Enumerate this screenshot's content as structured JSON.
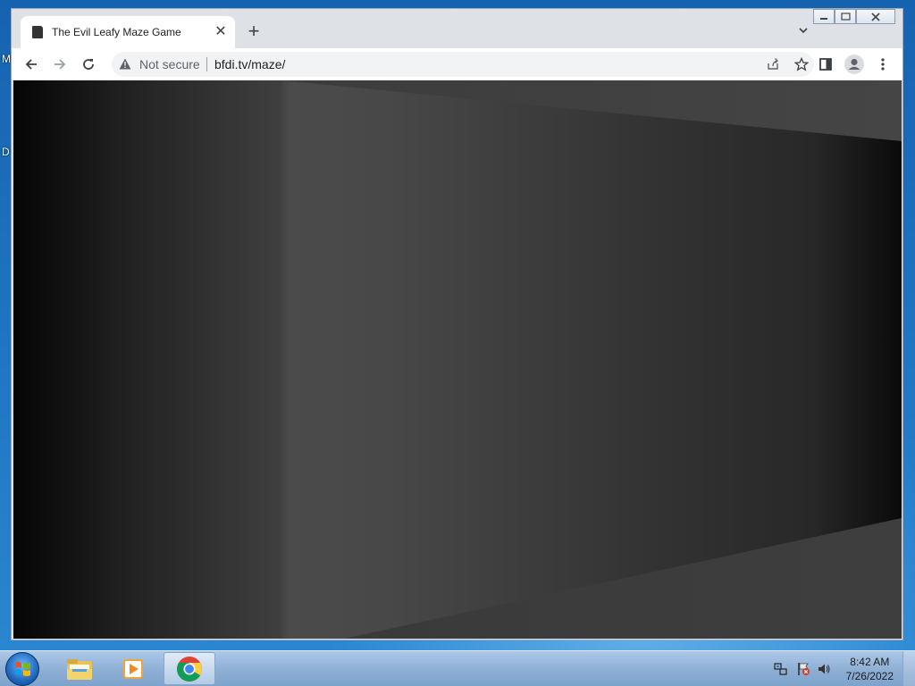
{
  "desktop": {
    "icon_labels": [
      "M",
      "D"
    ]
  },
  "browser": {
    "tab": {
      "title": "The Evil Leafy Maze Game",
      "close_glyph": "✕"
    },
    "new_tab_glyph": "+",
    "tab_search_glyph": "⌄",
    "window_controls": {
      "minimize": "▭",
      "maximize": "⧉",
      "close": "✕"
    },
    "omnibox": {
      "security_label": "Not secure",
      "url": "bfdi.tv/maze/"
    },
    "icons": {
      "back": "back-arrow-icon",
      "forward": "forward-arrow-icon",
      "reload": "reload-icon",
      "share": "share-icon",
      "bookmark": "star-icon",
      "side_panel": "side-panel-icon",
      "profile": "profile-avatar-icon",
      "menu": "kebab-menu-icon"
    }
  },
  "game": {
    "scene": "maze-3d-corridor",
    "colors": {
      "wall_light": "#4a4a4a",
      "wall_dark": "#0b0b0b",
      "ceiling": "#3a3a3a",
      "floor": "#3b3b3b"
    }
  },
  "taskbar": {
    "pinned": [
      "start-orb",
      "windows-explorer",
      "windows-media-player",
      "google-chrome"
    ],
    "clock": {
      "time": "8:42 AM",
      "date": "7/26/2022"
    }
  }
}
